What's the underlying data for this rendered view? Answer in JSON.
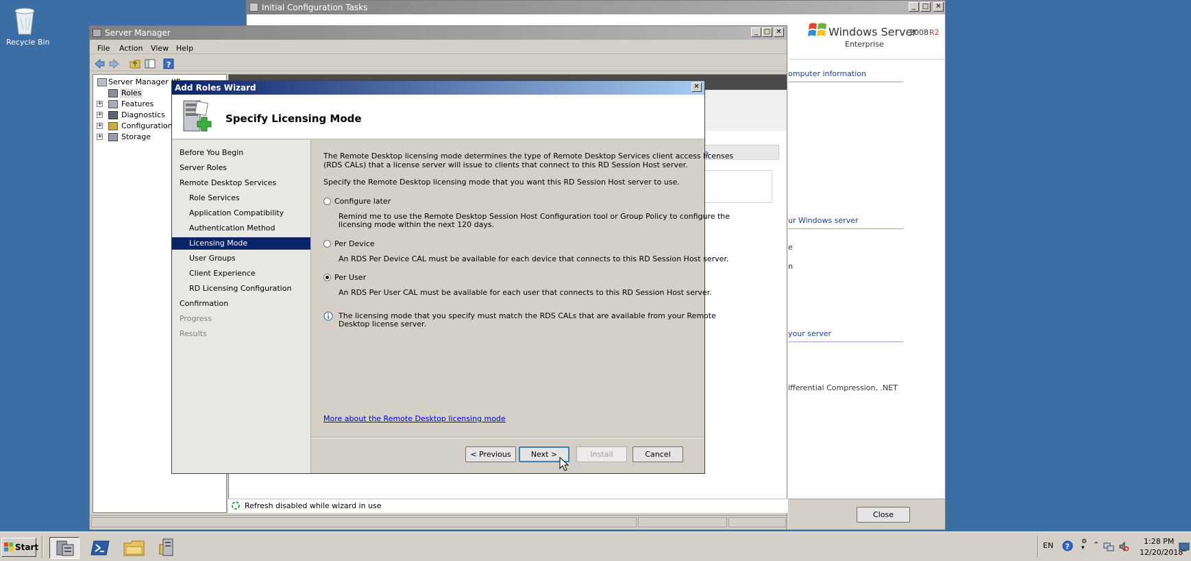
{
  "desktop": {
    "recycle_bin_label": "Recycle Bin"
  },
  "config_window": {
    "title": "Initial Configuration Tasks",
    "brand_windows": "Windows Server",
    "brand_version": "2008",
    "brand_r2": "R2",
    "brand_edition": "Enterprise",
    "section_computer_info": "omputer information",
    "section_windows_server": "ur Windows server",
    "frag_e": "e",
    "frag_n": "n",
    "section_your_server": "your server",
    "features_text": "ifferential Compression, .NET",
    "close_button": "Close"
  },
  "server_manager": {
    "title": "Server Manager",
    "menu": [
      "File",
      "Action",
      "View",
      "Help"
    ],
    "tree_root": "Server Manager (IE",
    "tree": [
      "Roles",
      "Features",
      "Diagnostics",
      "Configuration",
      "Storage"
    ],
    "status_text": "Refresh disabled while wizard in use",
    "bg_fragment": "p"
  },
  "wizard": {
    "title": "Add Roles Wizard",
    "heading": "Specify Licensing Mode",
    "nav": [
      {
        "label": "Before You Begin",
        "level": "top",
        "state": "normal"
      },
      {
        "label": "Server Roles",
        "level": "top",
        "state": "normal"
      },
      {
        "label": "Remote Desktop Services",
        "level": "top",
        "state": "normal"
      },
      {
        "label": "Role Services",
        "level": "sub",
        "state": "normal"
      },
      {
        "label": "Application Compatibility",
        "level": "sub",
        "state": "normal"
      },
      {
        "label": "Authentication Method",
        "level": "sub",
        "state": "normal"
      },
      {
        "label": "Licensing Mode",
        "level": "sub",
        "state": "selected"
      },
      {
        "label": "User Groups",
        "level": "sub",
        "state": "normal"
      },
      {
        "label": "Client Experience",
        "level": "sub",
        "state": "normal"
      },
      {
        "label": "RD Licensing Configuration",
        "level": "sub",
        "state": "normal"
      },
      {
        "label": "Confirmation",
        "level": "top",
        "state": "normal"
      },
      {
        "label": "Progress",
        "level": "top",
        "state": "disabled"
      },
      {
        "label": "Results",
        "level": "top",
        "state": "disabled"
      }
    ],
    "intro_line1": "The Remote Desktop licensing mode determines the type of Remote Desktop Services client access licenses",
    "intro_line2": "(RDS CALs) that a license server will issue to clients that connect to this RD Session Host server.",
    "instruction": "Specify the Remote Desktop licensing mode that you want this RD Session Host server to use.",
    "options": {
      "configure_later": {
        "label": "Configure later",
        "desc1": "Remind me to use the Remote Desktop Session Host Configuration tool or Group Policy to configure the",
        "desc2": "licensing mode within the next 120 days."
      },
      "per_device": {
        "label": "Per Device",
        "desc1": "An RDS Per Device CAL must be available for each device that connects to this RD Session Host server."
      },
      "per_user": {
        "label": "Per User",
        "desc1": "An RDS Per User CAL must be available for each user that connects to this RD Session Host server."
      }
    },
    "selected_option": "per_user",
    "info_line1": "The licensing mode that you specify must match the RDS CALs that are available from your Remote",
    "info_line2": "Desktop license server.",
    "more_link": "More about the Remote Desktop licensing mode",
    "buttons": {
      "previous": "< Previous",
      "next": "Next >",
      "install": "Install",
      "cancel": "Cancel"
    }
  },
  "taskbar": {
    "start_label": "Start",
    "language": "EN",
    "time": "1:28 PM",
    "date": "12/20/2018"
  },
  "colors": {
    "desktop": "#3a6ea5",
    "selection": "#0a246a",
    "link": "#0000cc",
    "taskbar": "#d4d0c8"
  }
}
